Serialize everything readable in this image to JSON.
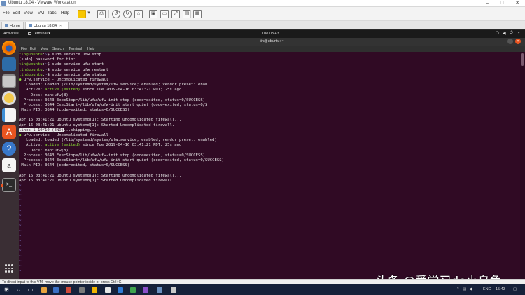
{
  "vm": {
    "window_title": "Ubuntu 18.04 - VMware Workstation",
    "menu": [
      "File",
      "Edit",
      "View",
      "VM",
      "Tabs",
      "Help"
    ],
    "tabs": [
      {
        "label": "Home"
      },
      {
        "label": "Ubuntu 18.04"
      }
    ],
    "status_message": "To direct input to this VM, move the mouse pointer inside or press Ctrl+G."
  },
  "ubuntu": {
    "activities": "Activities",
    "app_menu": "Terminal",
    "clock": "Tue 03:43"
  },
  "terminal": {
    "title": "tin@ubuntu: ~",
    "menu": [
      "File",
      "Edit",
      "View",
      "Search",
      "Terminal",
      "Help"
    ],
    "prompt_user": "tin@ubuntu",
    "prompt_path": "~",
    "lines": {
      "cmd1": "sudo service ufw stop",
      "sudo_prompt": "[sudo] password for tin:",
      "cmd2": "sudo service ufw start",
      "cmd3": "sudo service ufw restart",
      "cmd4": "sudo service ufw status",
      "svc1_head": "ufw.service - Uncomplicated firewall",
      "svc1_loaded": "   Loaded: loaded (/lib/systemd/system/ufw.service; enabled; vendor preset: enab",
      "svc1_active_pre": "   Active: ",
      "svc1_active_state": "active (exited)",
      "svc1_active_post": " since Tue 2019-04-16 03:41:21 PDT; 25s ago",
      "svc1_docs": "     Docs: man:ufw(8)",
      "svc1_proc1": "  Process: 3643 ExecStop=/lib/ufw/ufw-init stop (code=exited, status=0/SUCCESS)",
      "svc1_proc2": "  Process: 3644 ExecStart=/lib/ufw/ufw-init start quiet (code=exited, status=0/S",
      "svc1_pid": " Main PID: 3644 (code=exited, status=0/SUCCESS)",
      "log1": "Apr 16 03:41:21 ubuntu systemd[1]: Starting Uncomplicated firewall...",
      "log2": "Apr 16 03:41:21 ubuntu systemd[1]: Started Uncomplicated firewall.",
      "pager_status": "lines 1-10/10 (END)",
      "pager_skip": "...skipping...",
      "svc2_head": "ufw.service - Uncomplicated firewall",
      "svc2_loaded": "   Loaded: loaded (/lib/systemd/system/ufw.service; enabled; vendor preset: enabled)",
      "svc2_active_pre": "   Active: ",
      "svc2_active_state": "active (exited)",
      "svc2_active_post": " since Tue 2019-04-16 03:41:21 PDT; 25s ago",
      "svc2_docs": "     Docs: man:ufw(8)",
      "svc2_proc1": "  Process: 3643 ExecStop=/lib/ufw/ufw-init stop (code=exited, status=0/SUCCESS)",
      "svc2_proc2": "  Process: 3644 ExecStart=/lib/ufw/ufw-init start quiet (code=exited, status=0/SUCCESS)",
      "svc2_pid": " Main PID: 3644 (code=exited, status=0/SUCCESS)",
      "log3": "Apr 16 03:41:21 ubuntu systemd[1]: Starting Uncomplicated firewall...",
      "log4": "Apr 16 03:41:21 ubuntu systemd[1]: Started Uncomplicated firewall."
    },
    "tilde": "~"
  },
  "watermark": "头条 @爱学习de小乌龟",
  "taskbar": {
    "lang": "ENG",
    "time": "15:43"
  },
  "colors": {
    "terminal_bg": "#300a24",
    "prompt_green": "#8ae234",
    "ubuntu_orange": "#e95420"
  }
}
